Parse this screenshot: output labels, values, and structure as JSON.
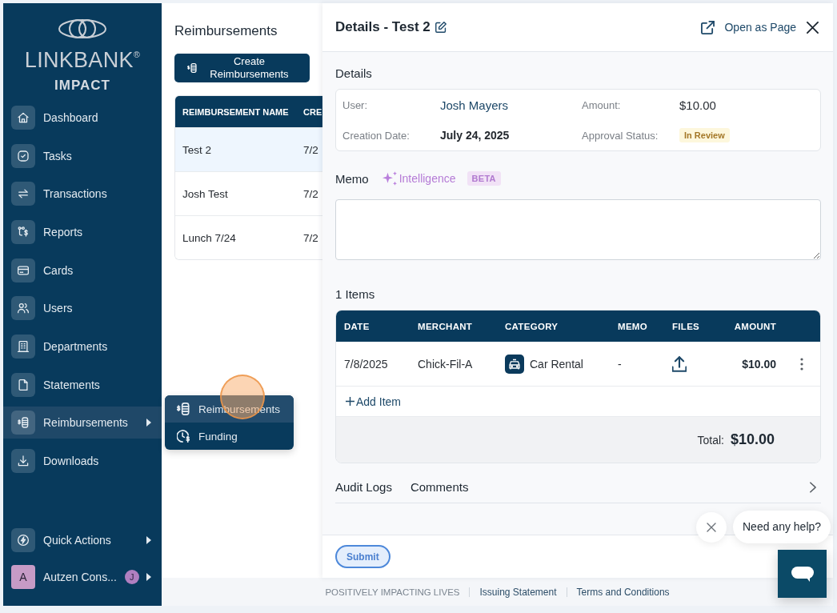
{
  "sidebar": {
    "logo": {
      "wordmark": "LINKBANK$^{®}$",
      "subtitle": "IMPACT"
    },
    "nav_items": [
      {
        "label": "Dashboard",
        "selected": false,
        "submenu": false
      },
      {
        "label": "Tasks",
        "selected": false,
        "submenu": false
      },
      {
        "label": "Transactions",
        "selected": false,
        "submenu": false
      },
      {
        "label": "Reports",
        "selected": false,
        "submenu": false
      },
      {
        "label": "Cards",
        "selected": false,
        "submenu": false
      },
      {
        "label": "Users",
        "selected": false,
        "submenu": false
      },
      {
        "label": "Departments",
        "selected": false,
        "submenu": false
      },
      {
        "label": "Statements",
        "selected": false,
        "submenu": false
      },
      {
        "label": "Reimbursements",
        "selected": true,
        "submenu": true
      },
      {
        "label": "Downloads",
        "selected": false,
        "submenu": false
      }
    ],
    "bottom_items": [
      {
        "kind": "action",
        "label": "Quick Actions",
        "submenu": true
      },
      {
        "kind": "account",
        "label": "Autzen Cons...",
        "avatar": "A",
        "badge": "J",
        "submenu": true
      }
    ]
  },
  "flyout": {
    "items": [
      {
        "label": "Reimbursements",
        "selected": true
      },
      {
        "label": "Funding",
        "selected": false
      }
    ]
  },
  "list_panel": {
    "title": "Reimbursements",
    "create_button": "Create Reimbursements",
    "table": {
      "columns": [
        "REIMBURSEMENT NAME",
        "CRE"
      ],
      "rows": [
        {
          "cells": [
            "Test 2",
            "7/2"
          ],
          "selected": true
        },
        {
          "cells": [
            "Josh Test",
            "7/2"
          ],
          "selected": false
        },
        {
          "cells": [
            "Lunch 7/24",
            "7/2"
          ],
          "selected": false
        }
      ]
    }
  },
  "details_panel": {
    "title": "Details - Test 2",
    "open_as_page": "Open as Page",
    "section_title": "Details",
    "fields": [
      {
        "label": "User:",
        "value": "Josh Mayers",
        "kind": "link"
      },
      {
        "label": "Amount:",
        "value": "$10.00",
        "kind": "plain"
      },
      {
        "label": "Creation Date:",
        "value": "July 24, 2025",
        "kind": "bold"
      },
      {
        "label": "Approval Status:",
        "value": "In Review",
        "kind": "badge"
      }
    ],
    "memo": {
      "label": "Memo",
      "assistant": "Intelligence",
      "badge": "BETA"
    },
    "items": {
      "title": "1 Items",
      "columns": [
        "DATE",
        "MERCHANT",
        "CATEGORY",
        "MEMO",
        "FILES",
        "AMOUNT"
      ],
      "rows": [
        {
          "date": "7/8/2025",
          "merchant": "Chick-Fil-A",
          "category": "Car Rental",
          "memo": "-",
          "amount": "$10.00"
        }
      ],
      "add_item": "Add Item",
      "total": {
        "label": "Total:",
        "value": "$10.00"
      }
    },
    "tabs": [
      {
        "label": "Audit Logs"
      },
      {
        "label": "Comments"
      }
    ],
    "submit": "Submit"
  },
  "footer": {
    "tagline": "POSITIVELY IMPACTING LIVES",
    "links": [
      "Issuing Statement",
      "Terms and Conditions"
    ]
  },
  "chat": {
    "prompt": "Need any help?"
  }
}
